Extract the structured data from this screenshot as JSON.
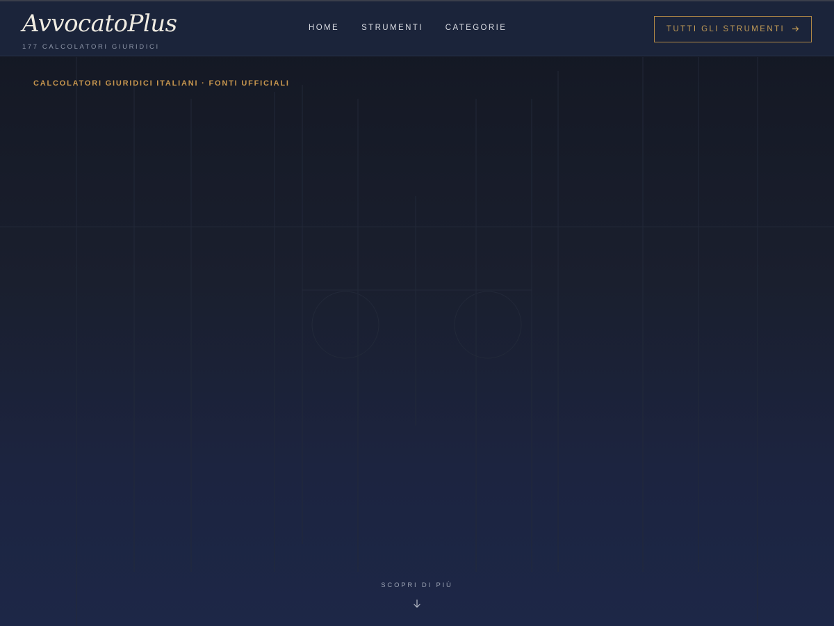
{
  "header": {
    "brand_title": "AvvocatoPlus",
    "brand_subtitle": "177 CALCOLATORI GIURIDICI",
    "nav": [
      {
        "label": "HOME"
      },
      {
        "label": "STRUMENTI"
      },
      {
        "label": "CATEGORIE"
      }
    ],
    "cta_label": "TUTTI GLI STRUMENTI",
    "cta_icon": "arrow-right-icon"
  },
  "hero": {
    "kicker": "CALCOLATORI GIURIDICI ITALIANI · FONTI UFFICIALI",
    "scroll_label": "SCOPRI DI PIÙ",
    "scroll_icon": "arrow-down-icon"
  },
  "colors": {
    "accent_gold": "#c7964e",
    "header_bg": "#1b243a",
    "text_light": "#f0ece2"
  }
}
